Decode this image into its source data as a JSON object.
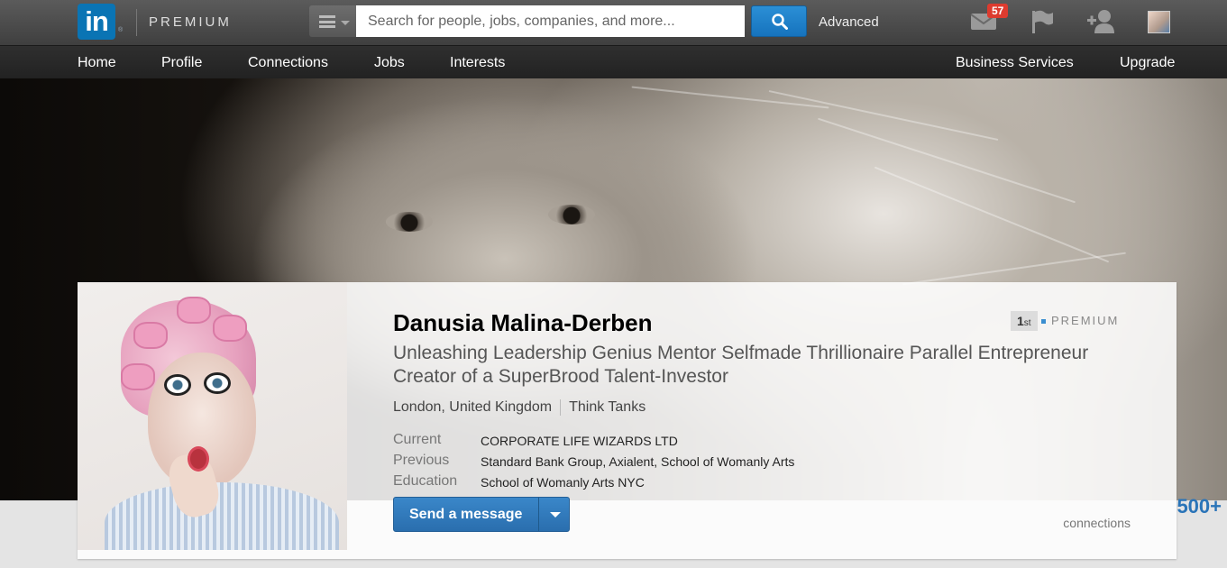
{
  "header": {
    "logo_text": "in",
    "logo_mark": "®",
    "premium_label": "PREMIUM",
    "search_placeholder": "Search for people, jobs, companies, and more...",
    "advanced_label": "Advanced",
    "inbox_badge": "57",
    "icons": [
      "menu-icon",
      "search-icon",
      "mail-icon",
      "flag-icon",
      "add-connection-icon",
      "avatar"
    ]
  },
  "nav": {
    "home": "Home",
    "profile": "Profile",
    "connections": "Connections",
    "jobs": "Jobs",
    "interests": "Interests",
    "business_services": "Business Services",
    "upgrade": "Upgrade"
  },
  "profile": {
    "name": "Danusia Malina-Derben",
    "degree": "1",
    "degree_suffix": "st",
    "premium_tag": "PREMIUM",
    "headline": "Unleashing Leadership Genius Mentor Selfmade Thrillionaire Parallel Entrepreneur Creator of a SuperBrood Talent-Investor",
    "location": "London, United Kingdom",
    "industry": "Think Tanks",
    "current_label": "Current",
    "current_value": "CORPORATE LIFE WIZARDS LTD",
    "previous_label": "Previous",
    "previous_value": "Standard Bank Group, Axialent, School of Womanly Arts",
    "education_label": "Education",
    "education_value": "School of Womanly Arts NYC",
    "send_message": "Send a message",
    "connections_count": "500+",
    "connections_label": "connections"
  },
  "colors": {
    "linkedin_blue": "#0a74b4",
    "button_blue": "#2a6eae",
    "badge_red": "#dd3b2f",
    "link_blue": "#2a74b8"
  }
}
